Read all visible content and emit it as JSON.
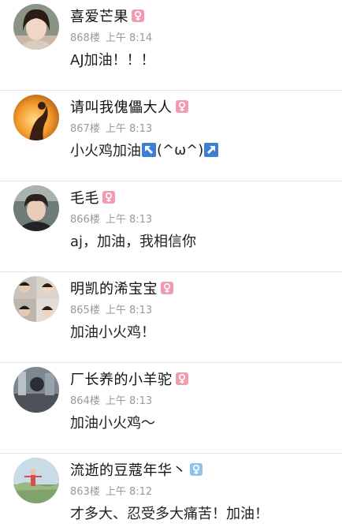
{
  "colors": {
    "female_badge": "#f29bb0",
    "male_badge": "#8fc3ec",
    "divider": "#e2e2e2"
  },
  "posts": [
    {
      "username": "喜爱芒果",
      "gender": "female",
      "floor": "868楼",
      "time": "上午 8:14",
      "content": "AJ加油！！！"
    },
    {
      "username": "请叫我傀儡大人",
      "gender": "female",
      "floor": "867楼",
      "time": "上午 8:13",
      "content_before": "小火鸡加油",
      "emoji_left": "upper-left-arrow-icon",
      "content_middle": "(^ω^)",
      "emoji_right": "upper-right-arrow-icon"
    },
    {
      "username": "毛毛",
      "gender": "female",
      "floor": "866楼",
      "time": "上午 8:13",
      "content": "aj，加油，我相信你"
    },
    {
      "username": "明凯的浠宝宝",
      "gender": "female",
      "floor": "865楼",
      "time": "上午 8:13",
      "content": "加油小火鸡！"
    },
    {
      "username": "厂长养的小羊驼",
      "gender": "female",
      "floor": "864楼",
      "time": "上午 8:13",
      "content": "加油小火鸡～"
    },
    {
      "username": "流逝的豆蔻年华丶",
      "gender": "male",
      "floor": "863楼",
      "time": "上午 8:12",
      "content": "才多大、忍受多大痛苦！加油！"
    }
  ]
}
